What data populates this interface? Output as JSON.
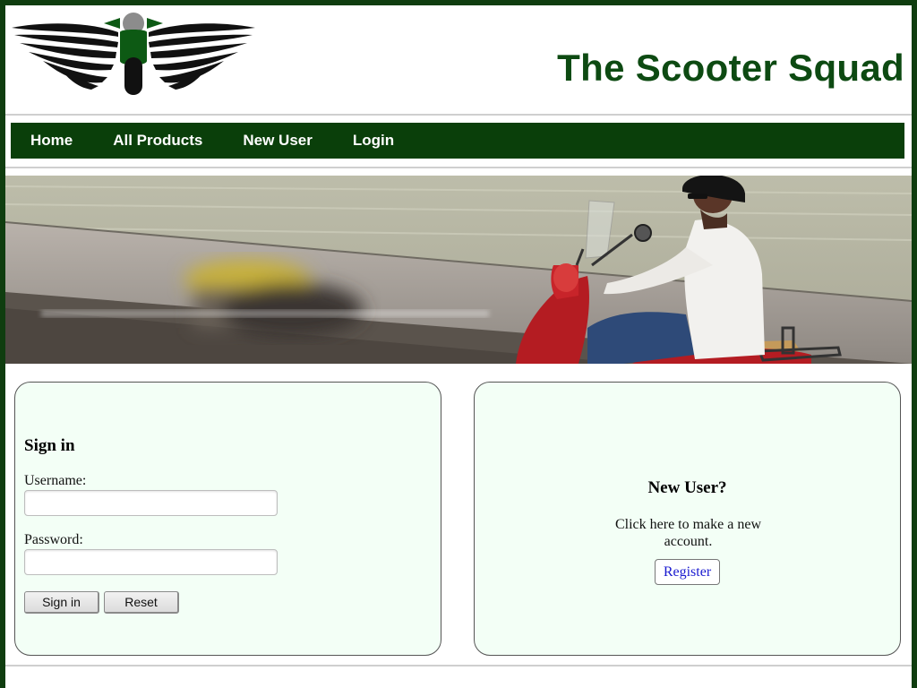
{
  "site": {
    "title": "The Scooter Squad",
    "brand_color": "#0d4a12"
  },
  "nav": {
    "items": [
      {
        "label": "Home"
      },
      {
        "label": "All Products"
      },
      {
        "label": "New User"
      },
      {
        "label": "Login"
      }
    ],
    "background": "#0a3f0a"
  },
  "banner": {
    "alt": "man riding a red scooter"
  },
  "signin": {
    "title": "Sign in",
    "username_label": "Username:",
    "username_value": "",
    "password_label": "Password:",
    "password_value": "",
    "sign_in_button": "Sign in",
    "reset_button": "Reset"
  },
  "new_user": {
    "title": "New User?",
    "text": "Click here to make a new account.",
    "register_button": "Register"
  },
  "icons": {
    "logo": "winged-scooter-logo-icon"
  }
}
